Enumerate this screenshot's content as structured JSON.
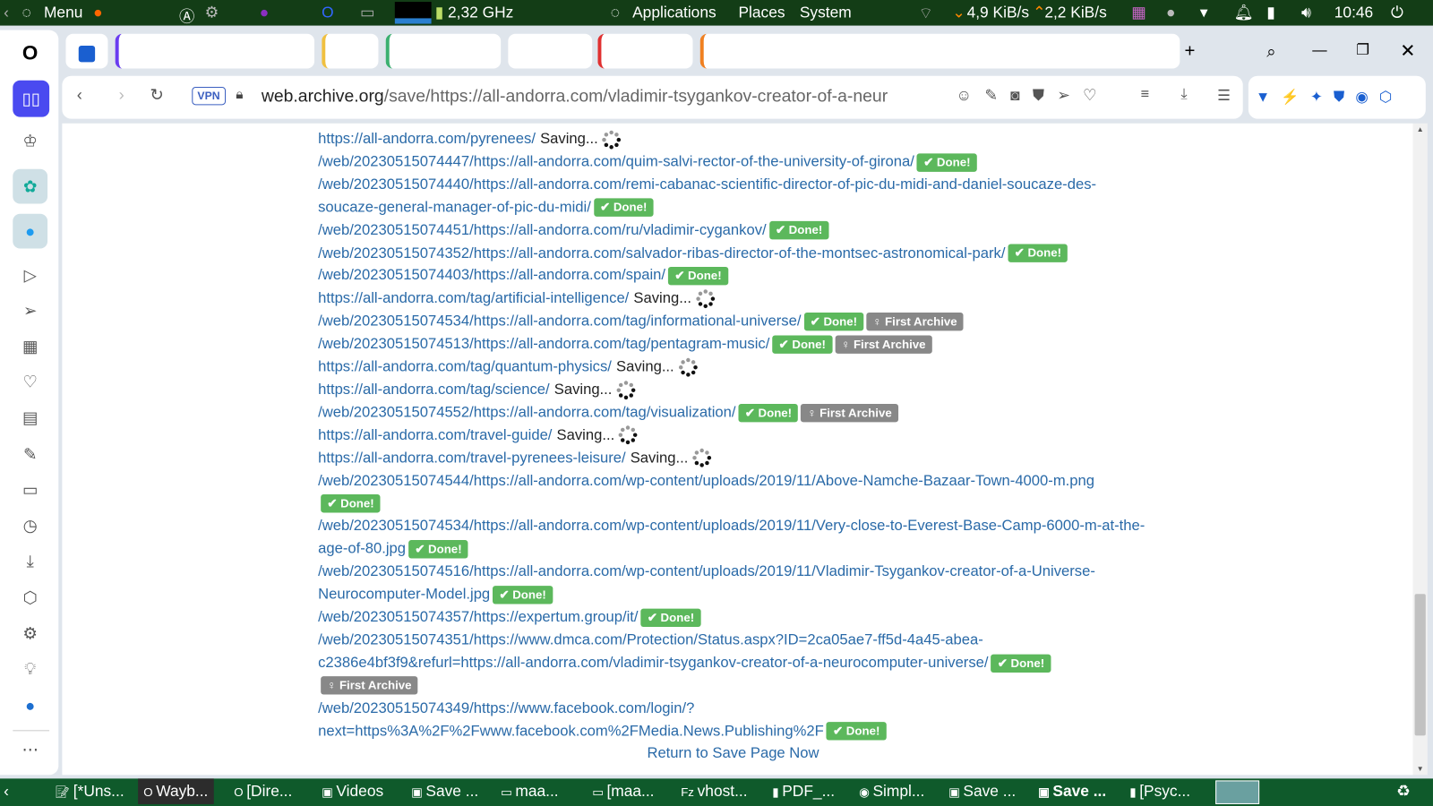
{
  "topbar": {
    "menu": "Menu",
    "cpu": "2,32 GHz",
    "applications": "Applications",
    "places": "Places",
    "system": "System",
    "net_down": "4,9 KiB/s",
    "net_up": "2,2 KiB/s",
    "clock": "10:46"
  },
  "browser": {
    "vpn": "VPN",
    "url_domain": "web.archive.org",
    "url_path": "/save/https://all-andorra.com/vladimir-tsygankov-creator-of-a-neur"
  },
  "entries": [
    {
      "url": "https://all-andorra.com/pyrenees/",
      "status": "Saving..."
    },
    {
      "url": "/web/20230515074447/https://all-andorra.com/quim-salvi-rector-of-the-university-of-girona/",
      "status": "Done!"
    },
    {
      "url": "/web/20230515074440/https://all-andorra.com/remi-cabanac-scientific-director-of-pic-du-midi-and-daniel-soucaze-des-soucaze-general-manager-of-pic-du-midi/",
      "status": "Done!"
    },
    {
      "url": "/web/20230515074451/https://all-andorra.com/ru/vladimir-cygankov/",
      "status": "Done!"
    },
    {
      "url": "/web/20230515074352/https://all-andorra.com/salvador-ribas-director-of-the-montsec-astronomical-park/",
      "status": "Done!"
    },
    {
      "url": "/web/20230515074403/https://all-andorra.com/spain/",
      "status": "Done!"
    },
    {
      "url": "https://all-andorra.com/tag/artificial-intelligence/",
      "status": "Saving..."
    },
    {
      "url": "/web/20230515074534/https://all-andorra.com/tag/informational-universe/",
      "status": "Done!",
      "first": "First Archive"
    },
    {
      "url": "/web/20230515074513/https://all-andorra.com/tag/pentagram-music/",
      "status": "Done!",
      "first": "First Archive"
    },
    {
      "url": "https://all-andorra.com/tag/quantum-physics/",
      "status": "Saving..."
    },
    {
      "url": "https://all-andorra.com/tag/science/",
      "status": "Saving..."
    },
    {
      "url": "/web/20230515074552/https://all-andorra.com/tag/visualization/",
      "status": "Done!",
      "first": "First Archive"
    },
    {
      "url": "https://all-andorra.com/travel-guide/",
      "status": "Saving..."
    },
    {
      "url": "https://all-andorra.com/travel-pyrenees-leisure/",
      "status": "Saving..."
    },
    {
      "url": "/web/20230515074544/https://all-andorra.com/wp-content/uploads/2019/11/Above-Namche-Bazaar-Town-4000-m.png",
      "status": "Done!"
    },
    {
      "url": "/web/20230515074534/https://all-andorra.com/wp-content/uploads/2019/11/Very-close-to-Everest-Base-Camp-6000-m-at-the-age-of-80.jpg",
      "status": "Done!"
    },
    {
      "url": "/web/20230515074516/https://all-andorra.com/wp-content/uploads/2019/11/Vladimir-Tsygankov-creator-of-a-Universe-Neurocomputer-Model.jpg",
      "status": "Done!"
    },
    {
      "url": "/web/20230515074357/https://expertum.group/it/",
      "status": "Done!"
    },
    {
      "url": "/web/20230515074351/https://www.dmca.com/Protection/Status.aspx?ID=2ca05ae7-ff5d-4a45-abea-c2386e4bf3f9&refurl=https://all-andorra.com/vladimir-tsygankov-creator-of-a-neurocomputer-universe/",
      "status": "Done!",
      "first": "First Archive"
    },
    {
      "url": "/web/20230515074349/https://www.facebook.com/login/?next=https%3A%2F%2Fwww.facebook.com%2FMedia.News.Publishing%2F",
      "status": "Done!"
    }
  ],
  "return_link": "Return to Save Page Now",
  "taskbar": [
    "[*Uns...",
    "Wayb...",
    "[Dire...",
    "Videos",
    "Save ...",
    "maa...",
    "[maa...",
    "vhost...",
    "PDF_...",
    "Simpl...",
    "Save ...",
    "Save ...",
    "[Psyc..."
  ]
}
